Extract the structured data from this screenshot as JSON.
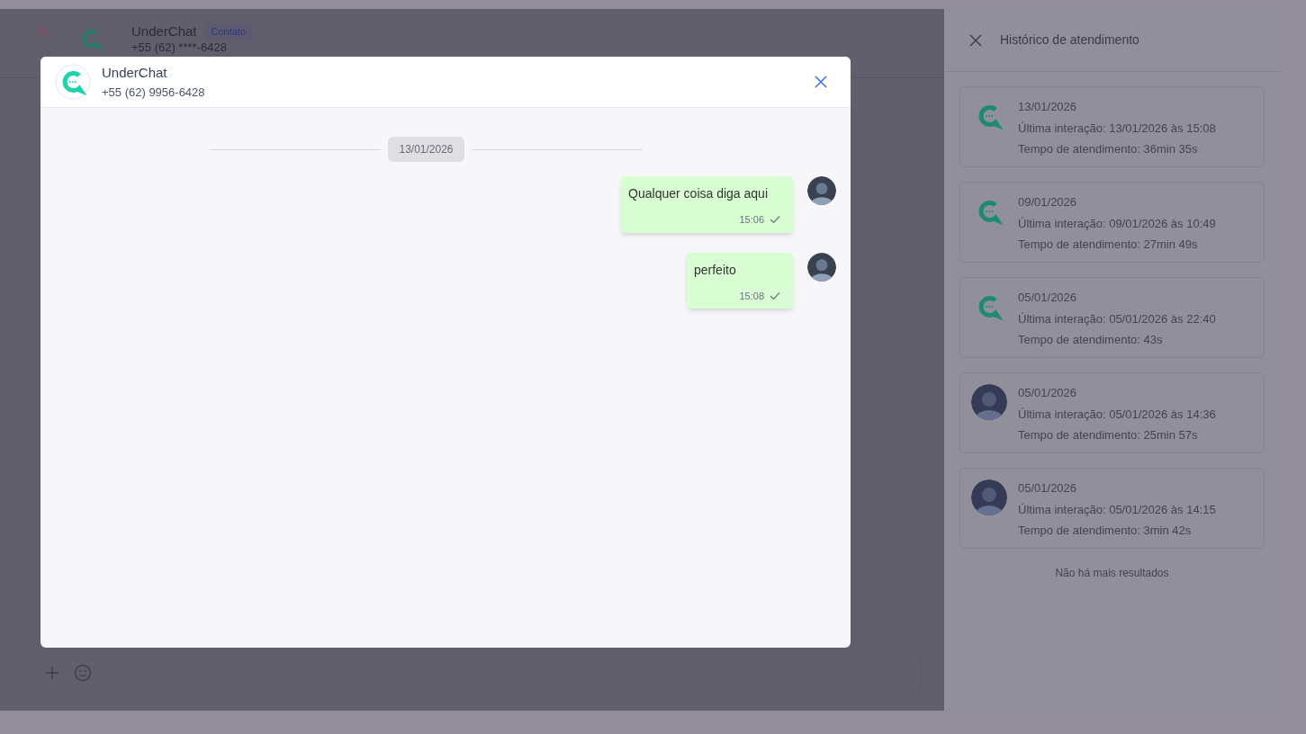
{
  "background_chat": {
    "contact_name": "UnderChat",
    "badge": "Contato",
    "phone": "+55 (62) ****-6428"
  },
  "modal": {
    "contact_name": "UnderChat",
    "phone": "+55 (62) 9956-6428",
    "date_separator": "13/01/2026",
    "messages": [
      {
        "text": "Qualquer coisa diga aqui",
        "time": "15:06",
        "delivered": true
      },
      {
        "text": "perfeito",
        "time": "15:08",
        "delivered": true
      }
    ]
  },
  "history_panel": {
    "title": "Histórico de atendimento",
    "items": [
      {
        "kind": "logo",
        "date": "13/01/2026",
        "last_interaction": "Última interação: 13/01/2026 às 15:08",
        "duration": "Tempo de atendimento: 36min 35s"
      },
      {
        "kind": "logo",
        "date": "09/01/2026",
        "last_interaction": "Última interação: 09/01/2026 às 10:49",
        "duration": "Tempo de atendimento: 27min 49s"
      },
      {
        "kind": "logo",
        "date": "05/01/2026",
        "last_interaction": "Última interação: 05/01/2026 às 22:40",
        "duration": "Tempo de atendimento: 43s"
      },
      {
        "kind": "person",
        "date": "05/01/2026",
        "last_interaction": "Última interação: 05/01/2026 às 14:36",
        "duration": "Tempo de atendimento: 25min 57s"
      },
      {
        "kind": "person",
        "date": "05/01/2026",
        "last_interaction": "Última interação: 05/01/2026 às 14:15",
        "duration": "Tempo de atendimento: 3min 42s"
      }
    ],
    "end_note": "Não há mais resultados"
  }
}
